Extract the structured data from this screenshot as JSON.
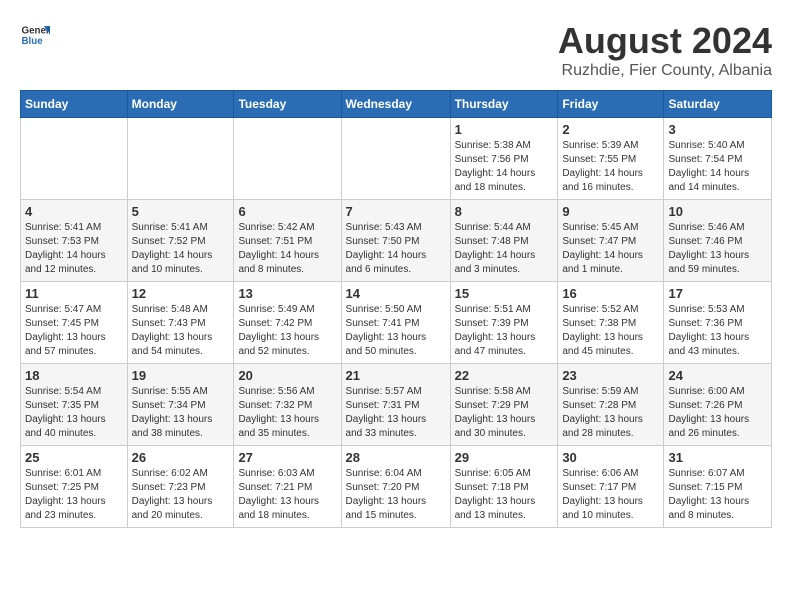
{
  "logo": {
    "text_general": "General",
    "text_blue": "Blue"
  },
  "title": "August 2024",
  "subtitle": "Ruzhdie, Fier County, Albania",
  "weekdays": [
    "Sunday",
    "Monday",
    "Tuesday",
    "Wednesday",
    "Thursday",
    "Friday",
    "Saturday"
  ],
  "weeks": [
    [
      {
        "day": "",
        "info": ""
      },
      {
        "day": "",
        "info": ""
      },
      {
        "day": "",
        "info": ""
      },
      {
        "day": "",
        "info": ""
      },
      {
        "day": "1",
        "info": "Sunrise: 5:38 AM\nSunset: 7:56 PM\nDaylight: 14 hours\nand 18 minutes."
      },
      {
        "day": "2",
        "info": "Sunrise: 5:39 AM\nSunset: 7:55 PM\nDaylight: 14 hours\nand 16 minutes."
      },
      {
        "day": "3",
        "info": "Sunrise: 5:40 AM\nSunset: 7:54 PM\nDaylight: 14 hours\nand 14 minutes."
      }
    ],
    [
      {
        "day": "4",
        "info": "Sunrise: 5:41 AM\nSunset: 7:53 PM\nDaylight: 14 hours\nand 12 minutes."
      },
      {
        "day": "5",
        "info": "Sunrise: 5:41 AM\nSunset: 7:52 PM\nDaylight: 14 hours\nand 10 minutes."
      },
      {
        "day": "6",
        "info": "Sunrise: 5:42 AM\nSunset: 7:51 PM\nDaylight: 14 hours\nand 8 minutes."
      },
      {
        "day": "7",
        "info": "Sunrise: 5:43 AM\nSunset: 7:50 PM\nDaylight: 14 hours\nand 6 minutes."
      },
      {
        "day": "8",
        "info": "Sunrise: 5:44 AM\nSunset: 7:48 PM\nDaylight: 14 hours\nand 3 minutes."
      },
      {
        "day": "9",
        "info": "Sunrise: 5:45 AM\nSunset: 7:47 PM\nDaylight: 14 hours\nand 1 minute."
      },
      {
        "day": "10",
        "info": "Sunrise: 5:46 AM\nSunset: 7:46 PM\nDaylight: 13 hours\nand 59 minutes."
      }
    ],
    [
      {
        "day": "11",
        "info": "Sunrise: 5:47 AM\nSunset: 7:45 PM\nDaylight: 13 hours\nand 57 minutes."
      },
      {
        "day": "12",
        "info": "Sunrise: 5:48 AM\nSunset: 7:43 PM\nDaylight: 13 hours\nand 54 minutes."
      },
      {
        "day": "13",
        "info": "Sunrise: 5:49 AM\nSunset: 7:42 PM\nDaylight: 13 hours\nand 52 minutes."
      },
      {
        "day": "14",
        "info": "Sunrise: 5:50 AM\nSunset: 7:41 PM\nDaylight: 13 hours\nand 50 minutes."
      },
      {
        "day": "15",
        "info": "Sunrise: 5:51 AM\nSunset: 7:39 PM\nDaylight: 13 hours\nand 47 minutes."
      },
      {
        "day": "16",
        "info": "Sunrise: 5:52 AM\nSunset: 7:38 PM\nDaylight: 13 hours\nand 45 minutes."
      },
      {
        "day": "17",
        "info": "Sunrise: 5:53 AM\nSunset: 7:36 PM\nDaylight: 13 hours\nand 43 minutes."
      }
    ],
    [
      {
        "day": "18",
        "info": "Sunrise: 5:54 AM\nSunset: 7:35 PM\nDaylight: 13 hours\nand 40 minutes."
      },
      {
        "day": "19",
        "info": "Sunrise: 5:55 AM\nSunset: 7:34 PM\nDaylight: 13 hours\nand 38 minutes."
      },
      {
        "day": "20",
        "info": "Sunrise: 5:56 AM\nSunset: 7:32 PM\nDaylight: 13 hours\nand 35 minutes."
      },
      {
        "day": "21",
        "info": "Sunrise: 5:57 AM\nSunset: 7:31 PM\nDaylight: 13 hours\nand 33 minutes."
      },
      {
        "day": "22",
        "info": "Sunrise: 5:58 AM\nSunset: 7:29 PM\nDaylight: 13 hours\nand 30 minutes."
      },
      {
        "day": "23",
        "info": "Sunrise: 5:59 AM\nSunset: 7:28 PM\nDaylight: 13 hours\nand 28 minutes."
      },
      {
        "day": "24",
        "info": "Sunrise: 6:00 AM\nSunset: 7:26 PM\nDaylight: 13 hours\nand 26 minutes."
      }
    ],
    [
      {
        "day": "25",
        "info": "Sunrise: 6:01 AM\nSunset: 7:25 PM\nDaylight: 13 hours\nand 23 minutes."
      },
      {
        "day": "26",
        "info": "Sunrise: 6:02 AM\nSunset: 7:23 PM\nDaylight: 13 hours\nand 20 minutes."
      },
      {
        "day": "27",
        "info": "Sunrise: 6:03 AM\nSunset: 7:21 PM\nDaylight: 13 hours\nand 18 minutes."
      },
      {
        "day": "28",
        "info": "Sunrise: 6:04 AM\nSunset: 7:20 PM\nDaylight: 13 hours\nand 15 minutes."
      },
      {
        "day": "29",
        "info": "Sunrise: 6:05 AM\nSunset: 7:18 PM\nDaylight: 13 hours\nand 13 minutes."
      },
      {
        "day": "30",
        "info": "Sunrise: 6:06 AM\nSunset: 7:17 PM\nDaylight: 13 hours\nand 10 minutes."
      },
      {
        "day": "31",
        "info": "Sunrise: 6:07 AM\nSunset: 7:15 PM\nDaylight: 13 hours\nand 8 minutes."
      }
    ]
  ]
}
